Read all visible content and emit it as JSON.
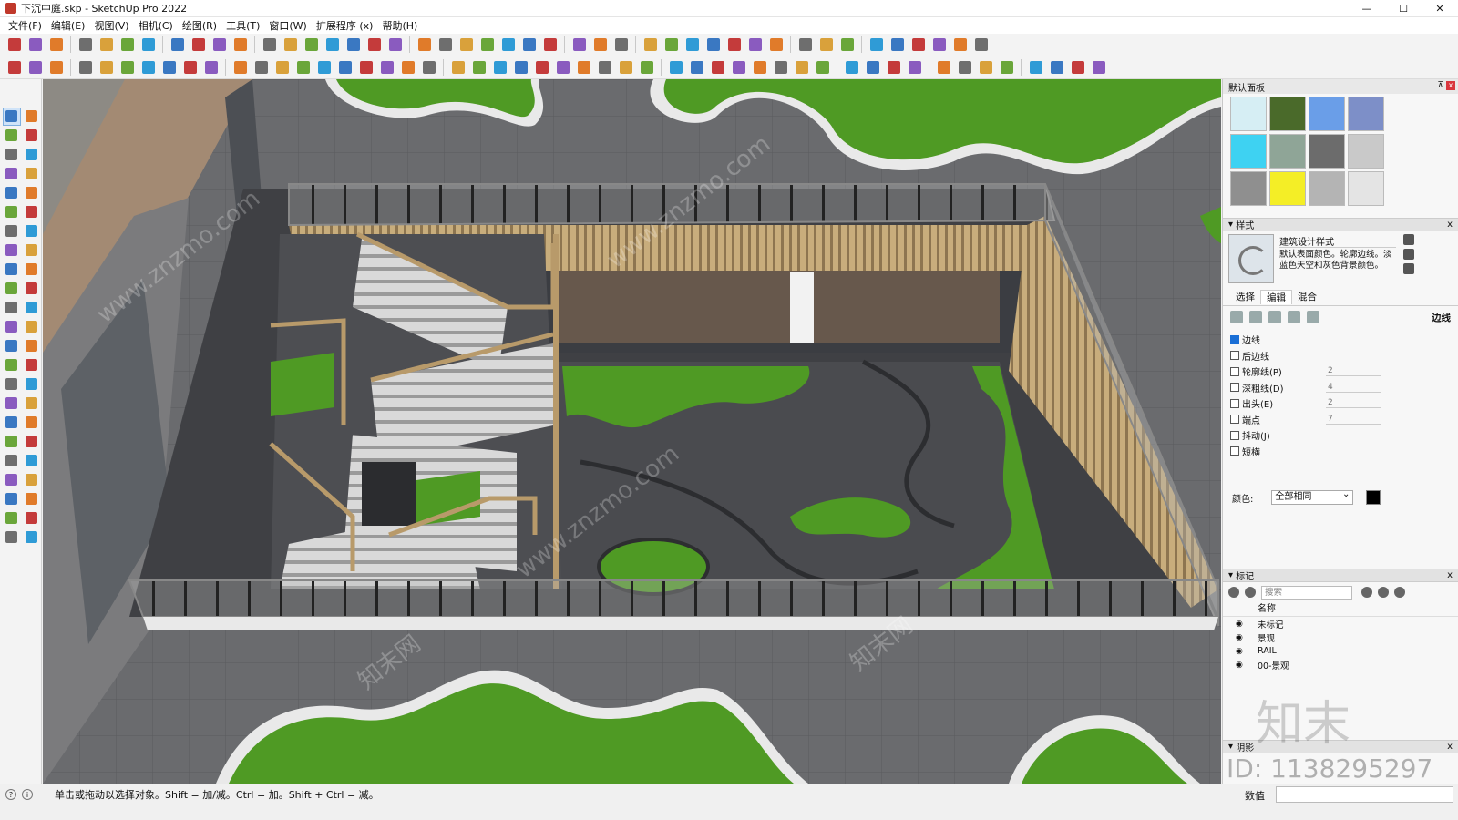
{
  "window": {
    "title": "下沉中庭.skp - SketchUp Pro 2022",
    "min": "—",
    "max": "☐",
    "close": "✕"
  },
  "menu": [
    "文件(F)",
    "编辑(E)",
    "视图(V)",
    "相机(C)",
    "绘图(R)",
    "工具(T)",
    "窗口(W)",
    "扩展程序 (x)",
    "帮助(H)"
  ],
  "default_tray": {
    "title": "默认面板",
    "pin": "⊼",
    "close": "x"
  },
  "styles": {
    "header": "样式",
    "close": "x",
    "style_name": "建筑设计样式",
    "style_desc": "默认表面颜色。轮廓边线。淡蓝色天空和灰色背景颜色。",
    "tabs": [
      "选择",
      "编辑",
      "混合"
    ],
    "active_tab": "编辑",
    "edit_section_label": "边线",
    "options": [
      {
        "label": "边线",
        "checked": true,
        "value": ""
      },
      {
        "label": "后边线",
        "checked": false,
        "value": ""
      },
      {
        "label": "轮廓线(P)",
        "checked": false,
        "value": "2"
      },
      {
        "label": "深粗线(D)",
        "checked": false,
        "value": "4"
      },
      {
        "label": "出头(E)",
        "checked": false,
        "value": "2"
      },
      {
        "label": "端点",
        "checked": false,
        "value": "7"
      },
      {
        "label": "抖动(J)",
        "checked": false,
        "value": ""
      },
      {
        "label": "短横",
        "checked": false,
        "value": ""
      }
    ],
    "color_label": "颜色:",
    "color_value": "全部相同",
    "color_swatch": "#000000"
  },
  "tags": {
    "header": "标记",
    "close": "x",
    "search_placeholder": "搜索",
    "column_name": "名称",
    "items": [
      "未标记",
      "景观",
      "RAIL",
      "00-景观"
    ]
  },
  "shadows": {
    "header": "阴影",
    "close": "x"
  },
  "status": {
    "message": "单击或拖动以选择对象。Shift = 加/减。Ctrl = 加。Shift + Ctrl = 减。",
    "measure_label": "数值"
  },
  "watermarks": {
    "site": "www.znzmo.com",
    "brand": "知末网",
    "logo": "知末",
    "id": "ID: 1138295297"
  },
  "colors": {
    "grass": "#4f9a24",
    "paving": "#6e6f72",
    "dark_paving": "#3f4044",
    "wood": "#b89a6a",
    "white_curb": "#e9e9e9"
  }
}
